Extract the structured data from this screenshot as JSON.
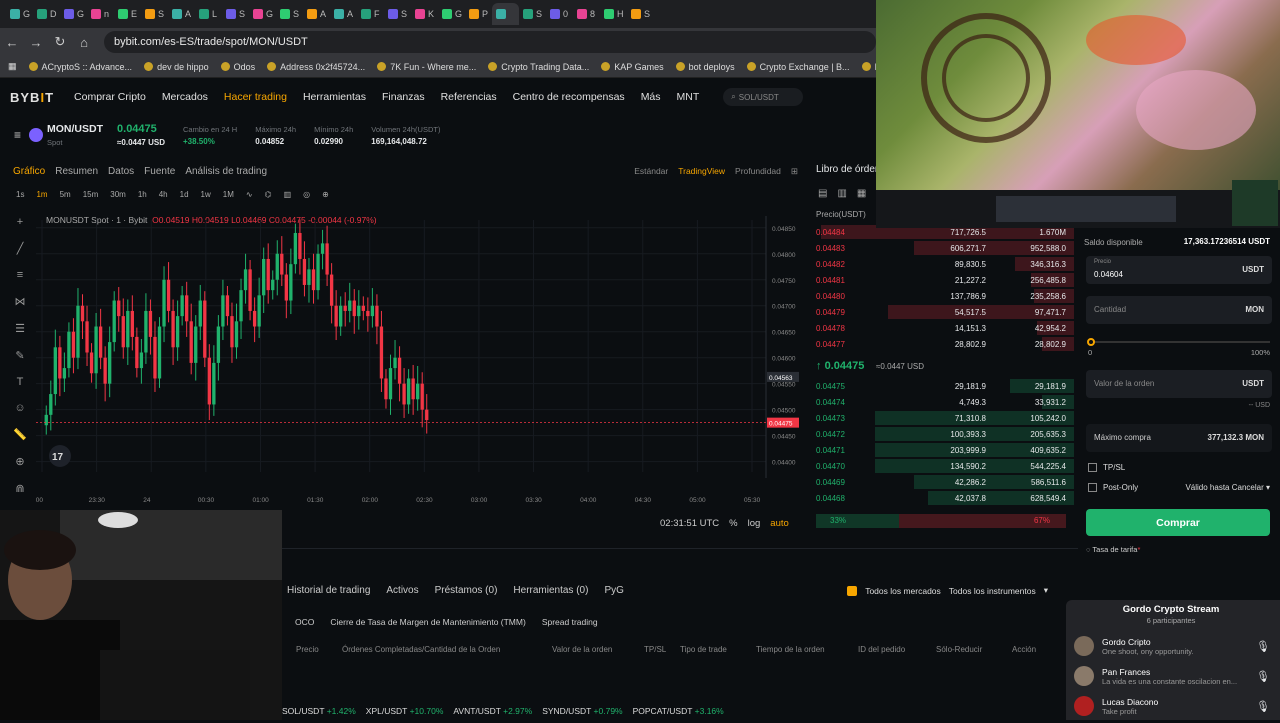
{
  "browser": {
    "tabs": [
      "G",
      "D",
      "G",
      "n",
      "E",
      "S",
      "A",
      "L",
      "S",
      "G",
      "S",
      "A",
      "A",
      "F",
      "S",
      "K",
      "G",
      "P",
      "",
      "S",
      "0",
      "8",
      "H",
      "S"
    ],
    "url": "bybit.com/es-ES/trade/spot/MON/USDT",
    "bookmarks": [
      "ACryptoS :: Advance...",
      "dev de hippo",
      "Odos",
      "Address 0x2f45724...",
      "7K Fun - Where me...",
      "Crypto Trading Data...",
      "KAP Games",
      "bot deploys",
      "Crypto Exchange | B...",
      "BidBit | Importan"
    ]
  },
  "nav": {
    "logo_a": "BYB",
    "logo_b": "I",
    "logo_c": "T",
    "items": [
      "Comprar Cripto",
      "Mercados",
      "Hacer trading",
      "Herramientas",
      "Finanzas",
      "Referencias",
      "Centro de recompensas",
      "Más",
      "MNT"
    ],
    "search": "SOL/USDT"
  },
  "ticker": {
    "pair": "MON/USDT",
    "type": "Spot",
    "price": "0.04475",
    "price_usd": "≈0.0447 USD",
    "change_label": "Cambio en 24 H",
    "change": "+38.50%",
    "high_label": "Máximo 24h",
    "high": "0.04852",
    "low_label": "Mínimo 24h",
    "low": "0.02990",
    "vol_label": "Volumen 24h(USDT)",
    "vol": "169,164,048.72"
  },
  "chart_panel": {
    "tabs": [
      "Gráfico",
      "Resumen",
      "Datos",
      "Fuente",
      "Análisis de trading"
    ],
    "views": [
      "Estándar",
      "TradingView",
      "Profundidad"
    ],
    "intervals": [
      "1s",
      "1m",
      "5m",
      "15m",
      "30m",
      "1h",
      "4h",
      "1d",
      "1w",
      "1M"
    ],
    "legend_name": "MONUSDT Spot · 1 · Bybit",
    "legend_ohlc": "O0.04519 H0.04519 L0.04469 C0.04475 -0.00044 (-0.97%)",
    "time": "02:31:51 UTC",
    "pct": "%",
    "log": "log",
    "auto": "auto"
  },
  "chart_data": {
    "type": "candlestick",
    "title": "",
    "x_ticks": [
      ":00",
      "23:30",
      "24",
      "00:30",
      "01:00",
      "01:30",
      "02:00",
      "02:30",
      "03:00",
      "03:30",
      "04:00",
      "04:30",
      "05:00",
      "05:30"
    ],
    "y_ticks": [
      "0.04850",
      "0.04800",
      "0.04750",
      "0.04700",
      "0.04650",
      "0.04600",
      "0.04550",
      "0.04500",
      "0.04450",
      "0.04400"
    ],
    "ylim": [
      0.0438,
      0.04865
    ],
    "last_price": 0.04475,
    "crosshair_label": "0.04563",
    "last_label": "0.04475",
    "closes": [
      0.0449,
      0.0453,
      0.0462,
      0.0456,
      0.0458,
      0.0465,
      0.046,
      0.047,
      0.0467,
      0.0461,
      0.0457,
      0.0466,
      0.046,
      0.0455,
      0.0463,
      0.0471,
      0.0468,
      0.0462,
      0.0469,
      0.0464,
      0.0458,
      0.0461,
      0.0469,
      0.0464,
      0.0456,
      0.0466,
      0.0475,
      0.0469,
      0.0462,
      0.0468,
      0.0472,
      0.0467,
      0.0459,
      0.0466,
      0.0471,
      0.046,
      0.0451,
      0.0459,
      0.0466,
      0.0472,
      0.0468,
      0.0462,
      0.0467,
      0.0473,
      0.0477,
      0.0469,
      0.0466,
      0.0472,
      0.0479,
      0.0473,
      0.0475,
      0.048,
      0.0476,
      0.0471,
      0.0478,
      0.0484,
      0.0479,
      0.0474,
      0.0477,
      0.0473,
      0.048,
      0.0482,
      0.0476,
      0.047,
      0.0466,
      0.047,
      0.0469,
      0.0471,
      0.0468,
      0.047,
      0.0469,
      0.0468,
      0.047,
      0.0466,
      0.0456,
      0.0452,
      0.0458,
      0.046,
      0.0455,
      0.0451,
      0.0456,
      0.0452,
      0.0455,
      0.045,
      0.0448
    ]
  },
  "orderbook": {
    "title": "Libro de órden",
    "header": "Precio(USDT)",
    "asks": [
      {
        "p": "0.04484",
        "a": "717,726.5",
        "t": "1.670M",
        "d": 0.95
      },
      {
        "p": "0.04483",
        "a": "606,271.7",
        "t": "952,588.0",
        "d": 0.6
      },
      {
        "p": "0.04482",
        "a": "89,830.5",
        "t": "346,316.3",
        "d": 0.22
      },
      {
        "p": "0.04481",
        "a": "21,227.2",
        "t": "256,485.8",
        "d": 0.16
      },
      {
        "p": "0.04480",
        "a": "137,786.9",
        "t": "235,258.6",
        "d": 0.15
      },
      {
        "p": "0.04479",
        "a": "54,517.5",
        "t": "97,471.7",
        "d": 0.7
      },
      {
        "p": "0.04478",
        "a": "14,151.3",
        "t": "42,954.2",
        "d": 0.14
      },
      {
        "p": "0.04477",
        "a": "28,802.9",
        "t": "28,802.9",
        "d": 0.12
      }
    ],
    "mid": "0.04475",
    "mid_sub": "≈0.0447 USD",
    "bids": [
      {
        "p": "0.04475",
        "a": "29,181.9",
        "t": "29,181.9",
        "d": 0.24
      },
      {
        "p": "0.04474",
        "a": "4,749.3",
        "t": "33,931.2",
        "d": 0.12
      },
      {
        "p": "0.04473",
        "a": "71,310.8",
        "t": "105,242.0",
        "d": 0.75
      },
      {
        "p": "0.04472",
        "a": "100,393.3",
        "t": "205,635.3",
        "d": 0.75
      },
      {
        "p": "0.04471",
        "a": "203,999.9",
        "t": "409,635.2",
        "d": 0.75
      },
      {
        "p": "0.04470",
        "a": "134,590.2",
        "t": "544,225.4",
        "d": 0.75
      },
      {
        "p": "0.04469",
        "a": "42,286.2",
        "t": "586,511.6",
        "d": 0.6
      },
      {
        "p": "0.04468",
        "a": "42,037.8",
        "t": "628,549.4",
        "d": 0.55
      }
    ],
    "buy_pct": "33%",
    "sell_pct": "67%"
  },
  "trade": {
    "balance_label": "Saldo disponible",
    "balance": "17,363.17236514 USDT",
    "price_label": "Precio",
    "price": "0.04604",
    "price_unit": "USDT",
    "qty_label": "Cantidad",
    "qty_unit": "MON",
    "slider_min": "0",
    "slider_max": "100%",
    "value_label": "Valor de la orden",
    "value_unit": "USDT",
    "value_usd": "-- USD",
    "max_label": "Máximo compra",
    "max_value": "377,132.3 MON",
    "tpsl": "TP/SL",
    "postonly": "Post-Only",
    "tif": "Válido hasta Cancelar",
    "buy": "Comprar",
    "fee": "Tasa de tarifa"
  },
  "bottom": {
    "tabs": [
      "Historial de trading",
      "Activos",
      "Préstamos (0)",
      "Herramientas (0)",
      "PyG"
    ],
    "sub": [
      "OCO",
      "Cierre de Tasa de Margen de Mantenimiento (TMM)",
      "Spread trading"
    ],
    "cols": [
      "Precio",
      "Órdenes Completadas/Cantidad de la Orden",
      "Valor de la orden",
      "TP/SL",
      "Tipo de trade",
      "Tiempo de la orden",
      "ID del pedido",
      "Sólo-Reducir",
      "Acción"
    ],
    "all_markets": "Todos los mercados",
    "all_instruments": "Todos los instrumentos"
  },
  "footticker": [
    {
      "s": "SOL/USDT",
      "c": "+1.42%"
    },
    {
      "s": "XPL/USDT",
      "c": "+10.70%"
    },
    {
      "s": "AVNT/USDT",
      "c": "+2.97%"
    },
    {
      "s": "SYND/USDT",
      "c": "+0.79%"
    },
    {
      "s": "POPCAT/USDT",
      "c": "+3.16%"
    }
  ],
  "discord": {
    "title": "Gordo Crypto Stream",
    "sub": "6 participantes",
    "users": [
      {
        "n": "Gordo Cripto",
        "s": "One shoot, ony opportunity."
      },
      {
        "n": "Pan Frances",
        "s": "La vida es una constante oscilacion en..."
      },
      {
        "n": "Lucas Diacono",
        "s": "Take profit"
      }
    ]
  },
  "colors": {
    "up": "#20b26c",
    "down": "#f23645",
    "accent": "#f7a600"
  }
}
